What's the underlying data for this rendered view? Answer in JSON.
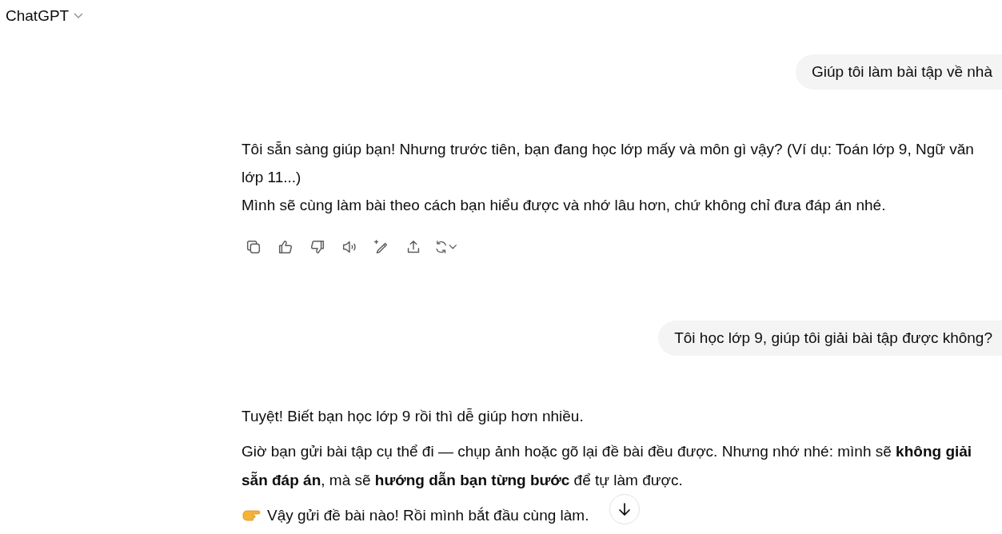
{
  "header": {
    "title": "ChatGPT"
  },
  "messages": [
    {
      "kind": "user",
      "text": "Giúp tôi làm bài tập về nhà"
    },
    {
      "kind": "assistant",
      "paragraphs": [
        {
          "kind": "text",
          "text": "Tôi sẵn sàng giúp bạn! Nhưng trước tiên, bạn đang học lớp mấy và môn gì vậy? (Ví dụ: Toán lớp 9, Ngữ văn lớp 11...)"
        },
        {
          "kind": "text",
          "text": "Mình sẽ cùng làm bài theo cách bạn hiểu được và nhớ lâu hơn, chứ không chỉ đưa đáp án nhé."
        }
      ],
      "actions": [
        {
          "kind": "copy"
        },
        {
          "kind": "like"
        },
        {
          "kind": "dislike"
        },
        {
          "kind": "read-aloud"
        },
        {
          "kind": "edit"
        },
        {
          "kind": "share"
        },
        {
          "kind": "regenerate"
        }
      ]
    },
    {
      "kind": "user",
      "text": "Tôi học lớp 9, giúp tôi giải bài tập được không?"
    },
    {
      "kind": "assistant",
      "paragraphs": [
        {
          "kind": "text",
          "text": "Tuyệt! Biết bạn học lớp 9 rồi thì dễ giúp hơn nhiều."
        },
        {
          "kind": "text",
          "text": "Giờ bạn gửi bài tập cụ thể đi — chụp ảnh hoặc gõ lại đề bài đều được. Nhưng nhớ nhé: mình sẽ **không giải sẵn đáp án**, mà sẽ **hướng dẫn bạn từng bước** để tự làm được."
        },
        {
          "kind": "pointing",
          "text": "Vậy gửi đề bài nào! Rồi mình bắt đầu cùng làm."
        }
      ]
    }
  ]
}
